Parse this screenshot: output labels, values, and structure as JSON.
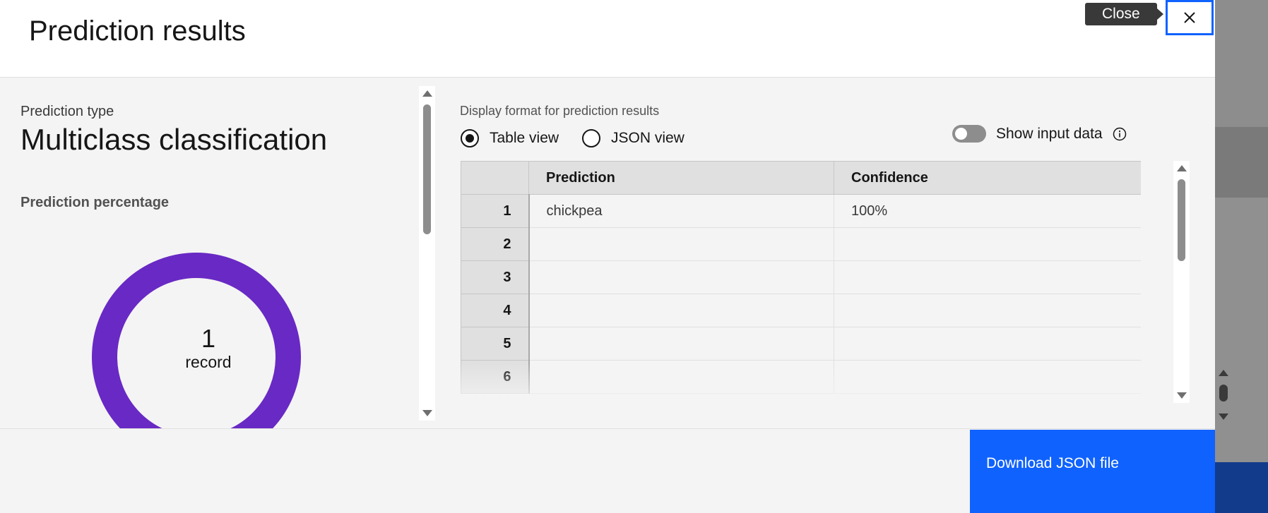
{
  "modal": {
    "title": "Prediction results",
    "close_tooltip": "Close"
  },
  "prediction": {
    "type_label": "Prediction type",
    "type_value": "Multiclass classification",
    "percentage_label": "Prediction percentage",
    "donut": {
      "count": "1",
      "unit": "record",
      "fill_fraction": 1.0,
      "color": "#6929c4"
    }
  },
  "display": {
    "label": "Display format for prediction results",
    "options": [
      {
        "label": "Table view",
        "selected": true
      },
      {
        "label": "JSON view",
        "selected": false
      }
    ],
    "show_input_label": "Show input data",
    "show_input_on": false
  },
  "table": {
    "columns": [
      "Prediction",
      "Confidence"
    ],
    "rows": [
      {
        "num": "1",
        "prediction": "chickpea",
        "confidence": "100%"
      },
      {
        "num": "2",
        "prediction": "",
        "confidence": ""
      },
      {
        "num": "3",
        "prediction": "",
        "confidence": ""
      },
      {
        "num": "4",
        "prediction": "",
        "confidence": ""
      },
      {
        "num": "5",
        "prediction": "",
        "confidence": ""
      },
      {
        "num": "6",
        "prediction": "",
        "confidence": ""
      }
    ]
  },
  "footer": {
    "download_label": "Download JSON file"
  },
  "colors": {
    "accent": "#0f62fe",
    "donut": "#6929c4"
  }
}
